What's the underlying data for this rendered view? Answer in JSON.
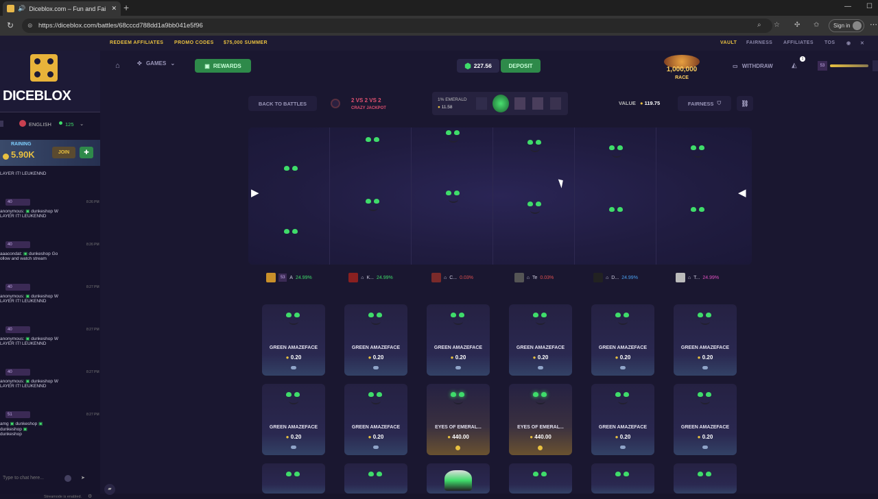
{
  "browser": {
    "tab_title": "Diceblox.com – Fun and Fai",
    "url": "https://diceblox.com/battles/68cccd788dd1a9bb041e5f96",
    "signin_label": "Sign in"
  },
  "topnav": {
    "left": [
      "REDEEM AFFILIATES",
      "PROMO CODES",
      "$75,000 SUMMER"
    ],
    "right": [
      "VAULT",
      "FAIRNESS",
      "AFFILIATES",
      "TOS"
    ]
  },
  "sidebar": {
    "brand": "DICEBLOX",
    "language": "ENGLISH",
    "online_count": "125",
    "rain_label": "RAINING",
    "rain_amount": "5.90K",
    "join_label": "JOIN",
    "chat": [
      {
        "level": "40",
        "time": "",
        "user": "",
        "text": "LAYER IT! LEUKENND"
      },
      {
        "level": "40",
        "time": "8:26 PM",
        "user": "anonymous",
        "mention": "dunkeshop",
        "text": "W",
        "line2": "LAYER IT! LEUKENND"
      },
      {
        "level": "40",
        "time": "8:26 PM",
        "user": "aaacondat",
        "mention": "dunkeshop",
        "text": "Go",
        "line2": "ollow and watch stream"
      },
      {
        "level": "40",
        "time": "8:27 PM",
        "user": "anonymous",
        "mention": "dunkeshop",
        "text": "W",
        "line2": "LAYER IT! LEUKENND"
      },
      {
        "level": "40",
        "time": "8:27 PM",
        "user": "anonymous",
        "mention": "dunkeshop",
        "text": "W",
        "line2": "LAYER IT! LEUKENND"
      },
      {
        "level": "40",
        "time": "8:27 PM",
        "user": "anonymous",
        "mention": "dunkeshop",
        "text": "W",
        "line2": "LAYER IT! LEUKENND"
      },
      {
        "level": "51",
        "time": "8:27 PM",
        "user": "amg",
        "mention": "dunkeshop",
        "text": "dunkeshop",
        "line2": "dunkeshop"
      }
    ],
    "chat_placeholder": "Type to chat here...",
    "footer_note": "Streamode is enabled."
  },
  "header": {
    "games_label": "GAMES",
    "rewards_label": "REWARDS",
    "balance": "227.56",
    "deposit_label": "DEPOSIT",
    "race_amount": "1,000,000",
    "race_label": "RACE",
    "withdraw_label": "WITHDRAW",
    "level": "53",
    "notif_count": "1"
  },
  "battle": {
    "back_label": "BACK TO BATTLES",
    "mode_title": "2 VS 2 VS 2",
    "mode_sub": "CRAZY JACKPOT",
    "case_name": "1% EMERALD",
    "case_price": "11.58",
    "value_label": "VALUE",
    "value_amount": "119.75",
    "fairness_label": "FAIRNESS"
  },
  "players": [
    {
      "name": "A",
      "level": "53",
      "pct": "24.99%",
      "color": "#3fdc6a"
    },
    {
      "name": "K...",
      "pct": "24.99%",
      "color": "#3fdc6a"
    },
    {
      "name": "C...",
      "pct": "0.03%",
      "color": "#e05050"
    },
    {
      "name": "Te",
      "pct": "0.03%",
      "color": "#e05050"
    },
    {
      "name": "D...",
      "pct": "24.99%",
      "color": "#4aa0f0"
    },
    {
      "name": "T...",
      "pct": "24.99%",
      "color": "#e050c0"
    }
  ],
  "items_row1": [
    {
      "name": "GREEN AMAZEFACE",
      "price": "0.20"
    },
    {
      "name": "GREEN AMAZEFACE",
      "price": "0.20"
    },
    {
      "name": "GREEN AMAZEFACE",
      "price": "0.20"
    },
    {
      "name": "GREEN AMAZEFACE",
      "price": "0.20"
    },
    {
      "name": "GREEN AMAZEFACE",
      "price": "0.20"
    },
    {
      "name": "GREEN AMAZEFACE",
      "price": "0.20"
    }
  ],
  "items_row2": [
    {
      "name": "GREEN AMAZEFACE",
      "price": "0.20"
    },
    {
      "name": "GREEN AMAZEFACE",
      "price": "0.20"
    },
    {
      "name": "EYES OF EMERAL...",
      "price": "440.00"
    },
    {
      "name": "EYES OF EMERAL...",
      "price": "440.00"
    },
    {
      "name": "GREEN AMAZEFACE",
      "price": "0.20"
    },
    {
      "name": "GREEN AMAZEFACE",
      "price": "0.20"
    }
  ],
  "colors": {
    "accent_green": "#3fdc6a",
    "gold": "#e8c040",
    "bg": "#1a1730"
  }
}
